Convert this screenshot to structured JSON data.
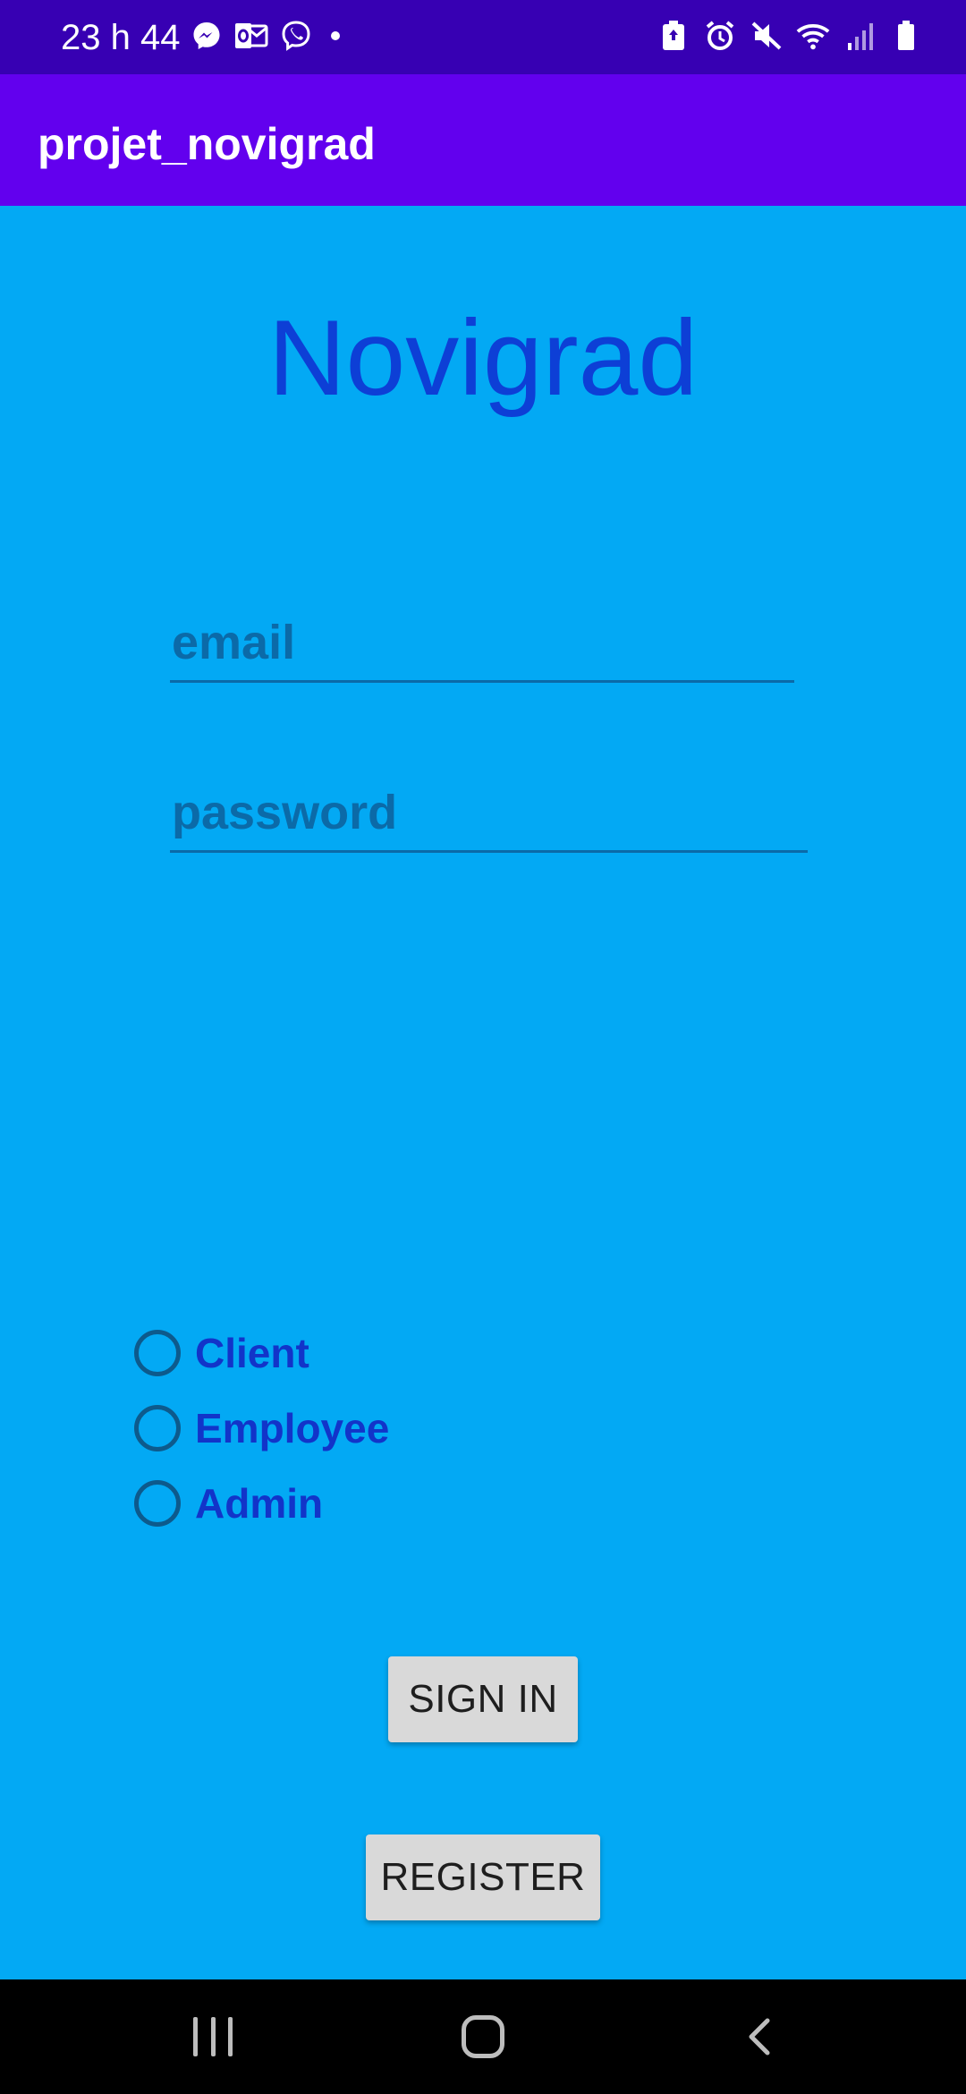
{
  "status_bar": {
    "time": "23 h 44",
    "left_icons": [
      "messenger-icon",
      "outlook-icon",
      "viber-icon",
      "notification-dot"
    ],
    "right_icons": [
      "battery-saver-icon",
      "alarm-icon",
      "mute-icon",
      "wifi-icon",
      "signal-icon",
      "battery-icon"
    ]
  },
  "app_bar": {
    "title": "projet_novigrad"
  },
  "main": {
    "brand_title": "Novigrad",
    "email_placeholder": "email",
    "password_placeholder": "password",
    "roles": [
      {
        "label": "Client",
        "selected": false
      },
      {
        "label": "Employee",
        "selected": false
      },
      {
        "label": "Admin",
        "selected": false
      }
    ],
    "sign_in_label": "SIGN IN",
    "register_label": "REGISTER"
  },
  "nav_bar": {
    "buttons": [
      "recent-apps",
      "home",
      "back"
    ]
  },
  "colors": {
    "status_bar": "#3700b3",
    "app_bar": "#6200ee",
    "background": "#03a9f4",
    "brand_title": "#0d3fd6",
    "radio_label": "#1234c9",
    "button_bg": "#d9d9d9"
  }
}
